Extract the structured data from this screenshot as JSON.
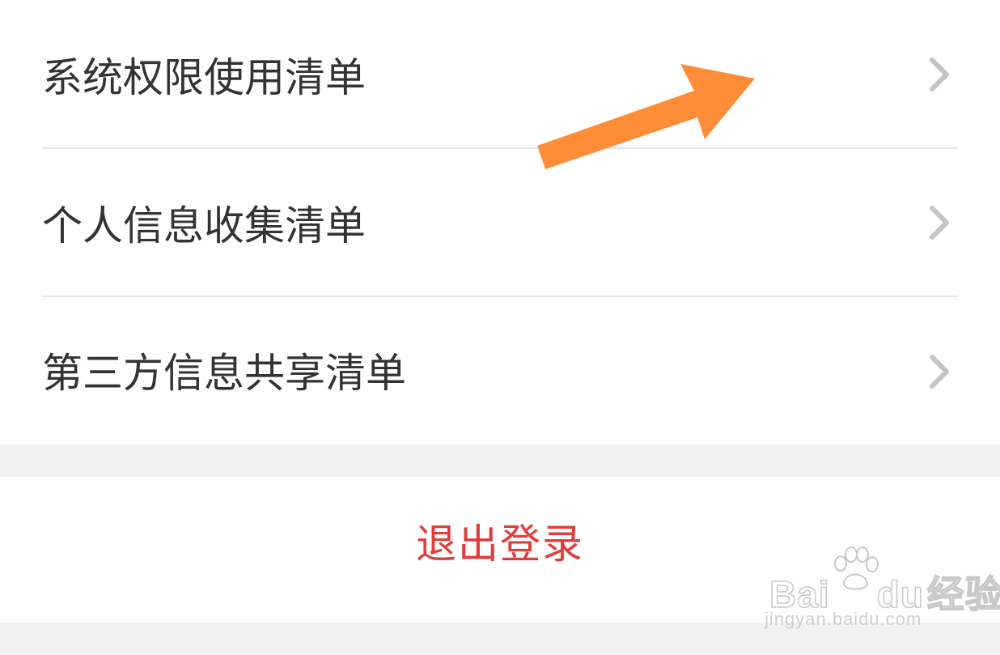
{
  "settings_list": {
    "items": [
      {
        "label": "系统权限使用清单",
        "icon": "chevron-right-icon"
      },
      {
        "label": "个人信息收集清单",
        "icon": "chevron-right-icon"
      },
      {
        "label": "第三方信息共享清单",
        "icon": "chevron-right-icon"
      }
    ]
  },
  "logout": {
    "label": "退出登录",
    "color": "#e03c3c"
  },
  "annotation": {
    "icon": "orange-arrow-icon",
    "color": "#ff8c37"
  },
  "watermark": {
    "brand": "Bai",
    "brand_suffix": "du",
    "brand_cn": "经验",
    "url": "jingyan.baidu.com"
  },
  "colors": {
    "background": "#f2f2f2",
    "row_text": "#333333",
    "divider": "#e6e6e6",
    "chevron": "#c4c4c4"
  }
}
